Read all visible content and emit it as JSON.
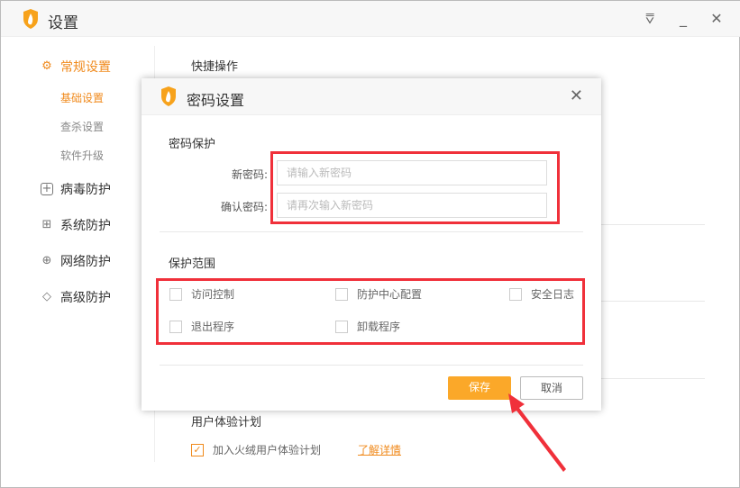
{
  "window": {
    "title": "设置",
    "icons": [
      "shield-flame-logo",
      "dropdown-menu-icon",
      "minimize-icon",
      "close-icon"
    ]
  },
  "sidebar": {
    "groups": [
      {
        "label": "常规设置",
        "icon": "gear-icon",
        "active": true,
        "items": [
          {
            "label": "基础设置",
            "active": true
          },
          {
            "label": "查杀设置"
          },
          {
            "label": "软件升级"
          }
        ]
      },
      {
        "label": "病毒防护",
        "icon": "plus-box-icon"
      },
      {
        "label": "系统防护",
        "icon": "grid-icon"
      },
      {
        "label": "网络防护",
        "icon": "globe-icon"
      },
      {
        "label": "高级防护",
        "icon": "diamond-icon"
      }
    ]
  },
  "main": {
    "quick_ops_title": "快捷操作",
    "ux_plan": {
      "title": "用户体验计划",
      "checkbox_label": "加入火绒用户体验计划",
      "checked": true,
      "link": "了解详情"
    }
  },
  "modal": {
    "title": "密码设置",
    "password_section": "密码保护",
    "new_password_label": "新密码:",
    "new_password_placeholder": "请输入新密码",
    "confirm_label": "确认密码:",
    "confirm_placeholder": "请再次输入新密码",
    "scope_section": "保护范围",
    "scope_items": [
      {
        "label": "访问控制",
        "checked": false
      },
      {
        "label": "防护中心配置",
        "checked": false
      },
      {
        "label": "安全日志",
        "checked": false
      },
      {
        "label": "退出程序",
        "checked": false
      },
      {
        "label": "卸载程序",
        "checked": false
      }
    ],
    "save": "保存",
    "cancel": "取消"
  },
  "colors": {
    "accent": "#f08a1c",
    "button": "#fba829",
    "highlight": "#f0303a"
  }
}
